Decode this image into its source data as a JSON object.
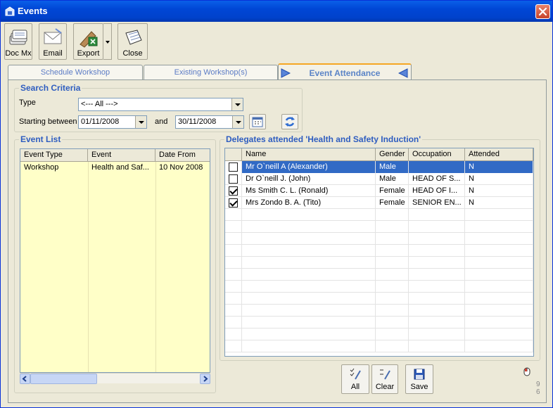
{
  "window": {
    "title": "Events",
    "title_icon": "events-icon",
    "close_icon": "close-icon"
  },
  "toolbar": {
    "docmx": {
      "label": "Doc Mx",
      "icon": "documents-stack-icon"
    },
    "email": {
      "label": "Email",
      "icon": "email-envelope-icon"
    },
    "export": {
      "label": "Export",
      "icon": "export-excel-icon"
    },
    "close": {
      "label": "Close",
      "icon": "close-book-icon"
    }
  },
  "tabs": [
    {
      "label": "Schedule Workshop"
    },
    {
      "label": "Existing Workshop(s)"
    },
    {
      "label": "Event Attendance"
    }
  ],
  "search": {
    "title": "Search Criteria",
    "type_label": "Type",
    "type_value": "<--- All --->",
    "starting_label": "Starting between",
    "from_date": "01/11/2008",
    "and_label": "and",
    "to_date": "30/11/2008"
  },
  "event_list": {
    "title": "Event List",
    "columns": [
      "Event Type",
      "Event",
      "Date From"
    ],
    "rows": [
      {
        "type": "Workshop",
        "event": "Health and Saf...",
        "date": "10 Nov 2008"
      }
    ]
  },
  "delegates": {
    "title": "Delegates attended 'Health and Safety Induction'",
    "columns": [
      "Name",
      "Gender",
      "Occupation",
      "Attended"
    ],
    "rows": [
      {
        "checked": false,
        "name": "Mr O`neill A (Alexander)",
        "gender": "Male",
        "occupation": "",
        "attended": "N"
      },
      {
        "checked": false,
        "name": "Dr O`neill J. (John)",
        "gender": "Male",
        "occupation": "HEAD OF S...",
        "attended": "N"
      },
      {
        "checked": true,
        "name": "Ms Smith C. L. (Ronald)",
        "gender": "Female",
        "occupation": "HEAD OF I...",
        "attended": "N"
      },
      {
        "checked": true,
        "name": "Mrs Zondo B. A. (Tito)",
        "gender": "Female",
        "occupation": "SENIOR EN...",
        "attended": "N"
      }
    ]
  },
  "actions": {
    "all": "All",
    "clear": "Clear",
    "save": "Save"
  },
  "version": {
    "line1": "9",
    "line2": "6"
  },
  "colors": {
    "title_bar": "#0046D5",
    "group_title": "#2E5DC0",
    "selection": "#316AC5",
    "event_list_bg": "#FFFFC8"
  }
}
